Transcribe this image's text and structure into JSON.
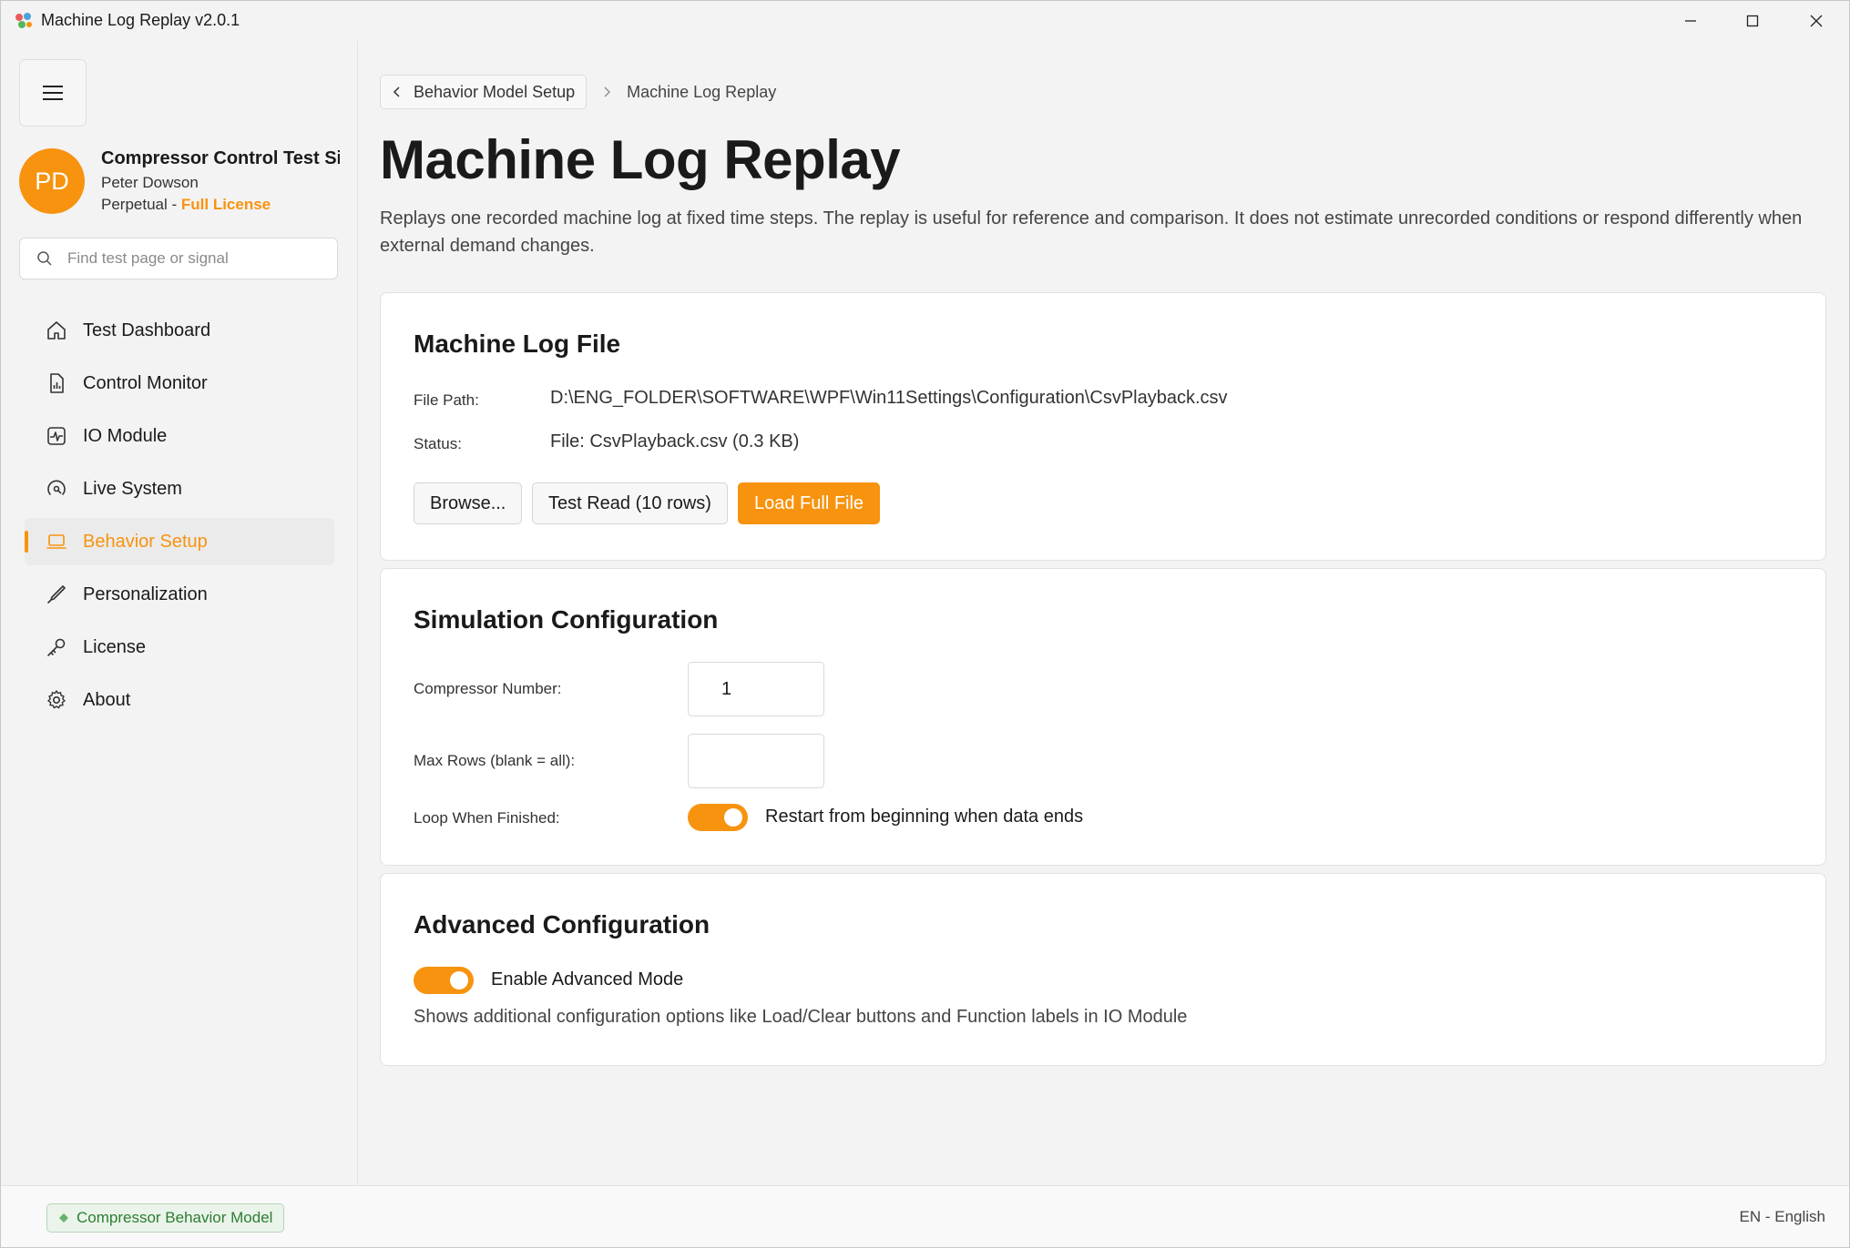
{
  "window": {
    "title": "Machine Log Replay v2.0.1",
    "controls": [
      "minimize-icon",
      "maximize-icon",
      "close-icon"
    ]
  },
  "colors": {
    "accent": "#f7930f",
    "status_green": "#2e7d32"
  },
  "sidebar": {
    "menu_icon": "hamburger-icon",
    "profile": {
      "initials": "PD",
      "app_name": "Compressor Control Test Simulator",
      "user": "Peter Dowson",
      "license_type": "Perpetual",
      "license_separator": " - ",
      "license_level": "Full License"
    },
    "search": {
      "placeholder": "Find test page or signal",
      "value": ""
    },
    "items": [
      {
        "label": "Test Dashboard",
        "icon": "home-icon",
        "active": false
      },
      {
        "label": "Control Monitor",
        "icon": "report-icon",
        "active": false
      },
      {
        "label": "IO Module",
        "icon": "pulse-icon",
        "active": false
      },
      {
        "label": "Live System",
        "icon": "live-signal-icon",
        "active": false
      },
      {
        "label": "Behavior Setup",
        "icon": "laptop-icon",
        "active": true
      },
      {
        "label": "Personalization",
        "icon": "brush-icon",
        "active": false
      },
      {
        "label": "License",
        "icon": "key-icon",
        "active": false
      },
      {
        "label": "About",
        "icon": "gear-icon",
        "active": false
      }
    ]
  },
  "breadcrumb": {
    "back_label": "Behavior Model Setup",
    "current": "Machine Log Replay"
  },
  "page": {
    "title": "Machine Log Replay",
    "description": "Replays one recorded machine log at fixed time steps. The replay is useful for reference and comparison. It does not estimate unrecorded conditions or respond differently when external demand changes."
  },
  "log_file": {
    "title": "Machine Log File",
    "path_label": "File Path:",
    "path_value": "D:\\ENG_FOLDER\\SOFTWARE\\WPF\\Win11Settings\\Configuration\\CsvPlayback.csv",
    "status_label": "Status:",
    "status_value": "File: CsvPlayback.csv (0.3 KB)",
    "buttons": {
      "browse": "Browse...",
      "test_read": "Test Read (10 rows)",
      "load_full": "Load Full File"
    }
  },
  "simulation": {
    "title": "Simulation Configuration",
    "compressor_label": "Compressor Number:",
    "compressor_value": "1",
    "max_rows_label": "Max Rows (blank = all):",
    "max_rows_value": "",
    "loop_label": "Loop When Finished:",
    "loop_enabled": true,
    "loop_text": "Restart from beginning when data ends"
  },
  "advanced": {
    "title": "Advanced Configuration",
    "enabled": true,
    "toggle_text": "Enable Advanced Mode",
    "hint": "Shows additional configuration options like Load/Clear buttons and Function labels in IO Module"
  },
  "footer": {
    "model_badge": "Compressor Behavior Model",
    "language": "EN - English"
  }
}
